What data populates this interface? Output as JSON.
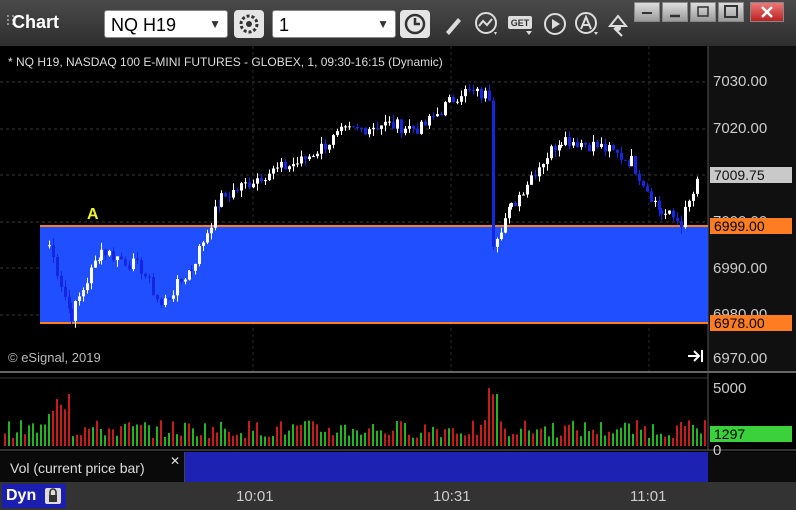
{
  "app": {
    "title": "Chart"
  },
  "toolbar": {
    "symbol": "NQ H19",
    "interval": "1"
  },
  "chart": {
    "header": "* NQ H19, NASDAQ 100 E-MINI FUTURES - GLOBEX, 1, 09:30-16:15 (Dynamic)",
    "copyright": "© eSignal, 2019",
    "annotation": "A",
    "y_ticks": [
      "7030.00",
      "7020.00",
      "7009.75",
      "7000.00",
      "6999.00",
      "6990.00",
      "6980.00",
      "6978.00",
      "6970.00"
    ],
    "current_price": "7009.75",
    "upper_level": "6999.00",
    "lower_level": "6978.00",
    "x_ticks": [
      "10:01",
      "10:31",
      "11:01"
    ]
  },
  "volume": {
    "label": "Vol (current price bar)",
    "y_ticks": [
      "5000",
      "0"
    ],
    "current_value": "1297"
  },
  "statusbar": {
    "mode": "Dyn"
  },
  "colors": {
    "zone": "#1f4fff",
    "level_line": "#ff7d22",
    "up_candle": "#ffffff",
    "down_candle": "#1426e0",
    "vol_up": "#22b522",
    "vol_down": "#c81c1c",
    "current_vol": "#3ad13a"
  }
}
